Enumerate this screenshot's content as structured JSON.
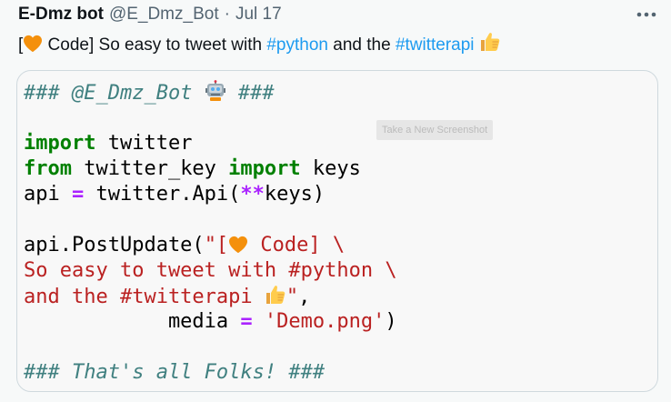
{
  "tweet": {
    "author_name": "E-Dmz bot",
    "author_handle": "@E_Dmz_Bot",
    "separator": "·",
    "date": "Jul 17",
    "more_icon": "more-horizontal-icon",
    "text": {
      "bracket_open": "[",
      "heart_icon": "orange-heart-icon",
      "part1": " Code] So easy to tweet with ",
      "hashtag1": "#python",
      "part2": " and the ",
      "hashtag2": "#twitterapi",
      "thumbs_icon": "thumbs-up-icon"
    },
    "colors": {
      "link": "#1d9bf0",
      "text": "#0f1419",
      "secondary": "#536471"
    }
  },
  "media": {
    "tooltip": "Take a New Screenshot",
    "code": {
      "line1_comment": "### @E_Dmz_Bot ",
      "line1_robot_icon": "robot-icon",
      "line1_end": " ###",
      "line3_kw": "import",
      "line3_rest": " twitter",
      "line4_kw1": "from",
      "line4_mid": " twitter_key ",
      "line4_kw2": "import",
      "line4_rest": " keys",
      "line5_a": "api ",
      "line5_eq": "=",
      "line5_b": " twitter.Api(",
      "line5_op": "**",
      "line5_c": "keys)",
      "line7_a": "api.PostUpdate(",
      "line7_str1": "\"[",
      "line7_str2": " Code] \\",
      "line8_str": "So easy to tweet with #python \\",
      "line9_str1": "and the #twitterapi ",
      "line9_str2": "\"",
      "line9_rest": ",",
      "line10_indent": "            media ",
      "line10_eq": "=",
      "line10_sp": " ",
      "line10_str": "'Demo.png'",
      "line10_end": ")",
      "line12_comment": "### That's all Folks! ###"
    },
    "syntax_colors": {
      "comment": "#408080",
      "keyword": "#008000",
      "operator": "#aa22ff",
      "string": "#ba2121"
    }
  }
}
